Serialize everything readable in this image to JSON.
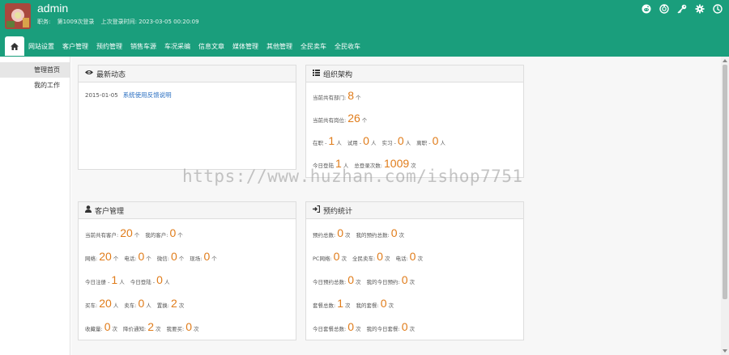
{
  "header": {
    "username": "admin",
    "role_label": "职务:",
    "login_count": "第1009次登录",
    "last_login": "上次登录时间: 2023-03-05 00:20:09",
    "icons": [
      "reddit-icon",
      "headset-icon",
      "key-icon",
      "gear-icon",
      "power-icon"
    ]
  },
  "nav": {
    "home_icon": "home-icon",
    "items": [
      "网站设置",
      "客户管理",
      "预约管理",
      "销售车源",
      "车况采编",
      "信息文章",
      "媒体管理",
      "其他管理",
      "全民卖车",
      "全民收车"
    ]
  },
  "sidebar": {
    "items": [
      "管理首页",
      "我的工作"
    ]
  },
  "panels": {
    "news": {
      "title": "最新动态",
      "icon": "eye-icon",
      "date": "2015-01-05",
      "link": "系统使用反馈说明"
    },
    "org": {
      "title": "组织架构",
      "icon": "list-icon",
      "dept_label": "当前共有部门:",
      "dept_num": "8",
      "dept_unit": "个",
      "post_label": "当前共有岗位:",
      "post_num": "26",
      "post_unit": "个",
      "zaizhi_label": "在职 -",
      "zaizhi_num": "1",
      "zaizhi_unit": "人",
      "shiyong_label": "试用 -",
      "shiyong_num": "0",
      "shiyong_unit": "人",
      "shixi_label": "实习 -",
      "shixi_num": "0",
      "shixi_unit": "人",
      "lizhi_label": "离职 -",
      "lizhi_num": "0",
      "lizhi_unit": "人",
      "today_label": "今日登陆",
      "today_num": "1",
      "today_unit": "人",
      "total_label": "总登录次数:",
      "total_num": "1009",
      "total_unit": "次"
    },
    "customer": {
      "title": "客户管理",
      "icon": "user-icon",
      "all_label": "当前共有客户:",
      "all_num": "20",
      "all_unit": "个",
      "mine_label": "我的客户:",
      "mine_num": "0",
      "mine_unit": "个",
      "net_label": "网络:",
      "net_num": "20",
      "net_unit": "个",
      "phone_label": "电话:",
      "phone_num": "0",
      "phone_unit": "个",
      "wechat_label": "微信:",
      "wechat_num": "0",
      "wechat_unit": "个",
      "site_label": "现场:",
      "site_num": "0",
      "site_unit": "个",
      "reg_label": "今日注册 -",
      "reg_num": "1",
      "reg_unit": "人",
      "login_label": "今日登陆 -",
      "login_num": "0",
      "login_unit": "人",
      "buy_label": "买车:",
      "buy_num": "20",
      "buy_unit": "人",
      "sell_label": "卖车:",
      "sell_num": "0",
      "sell_unit": "人",
      "swap_label": "置换:",
      "swap_num": "2",
      "swap_unit": "次",
      "fav_label": "收藏量:",
      "fav_num": "0",
      "fav_unit": "次",
      "price_label": "降价通知:",
      "price_num": "2",
      "price_unit": "次",
      "want_label": "我要买:",
      "want_num": "0",
      "want_unit": "次"
    },
    "booking": {
      "title": "预约统计",
      "icon": "sign-in-icon",
      "total_label": "预约总数:",
      "total_num": "0",
      "total_unit": "次",
      "mine_label": "我的预约总数:",
      "mine_num": "0",
      "mine_unit": "次",
      "pc_label": "PC网络:",
      "pc_num": "0",
      "pc_unit": "次",
      "sell_label": "全民卖车:",
      "sell_num": "0",
      "sell_unit": "次",
      "tel_label": "电话:",
      "tel_num": "0",
      "tel_unit": "次",
      "today_label": "今日预约总数:",
      "today_num": "0",
      "today_unit": "次",
      "mytoday_label": "我的今日预约:",
      "mytoday_num": "0",
      "mytoday_unit": "次",
      "rent_label": "套餐总数:",
      "rent_num": "1",
      "rent_unit": "次",
      "myrent_label": "我的套餐:",
      "myrent_num": "0",
      "myrent_unit": "次",
      "todayrent_label": "今日套餐总数:",
      "todayrent_num": "0",
      "todayrent_unit": "次",
      "mytodayrent_label": "我的今日套餐:",
      "mytodayrent_num": "0",
      "mytodayrent_unit": "次"
    }
  },
  "watermark": "https://www.huzhan.com/ishop7751"
}
